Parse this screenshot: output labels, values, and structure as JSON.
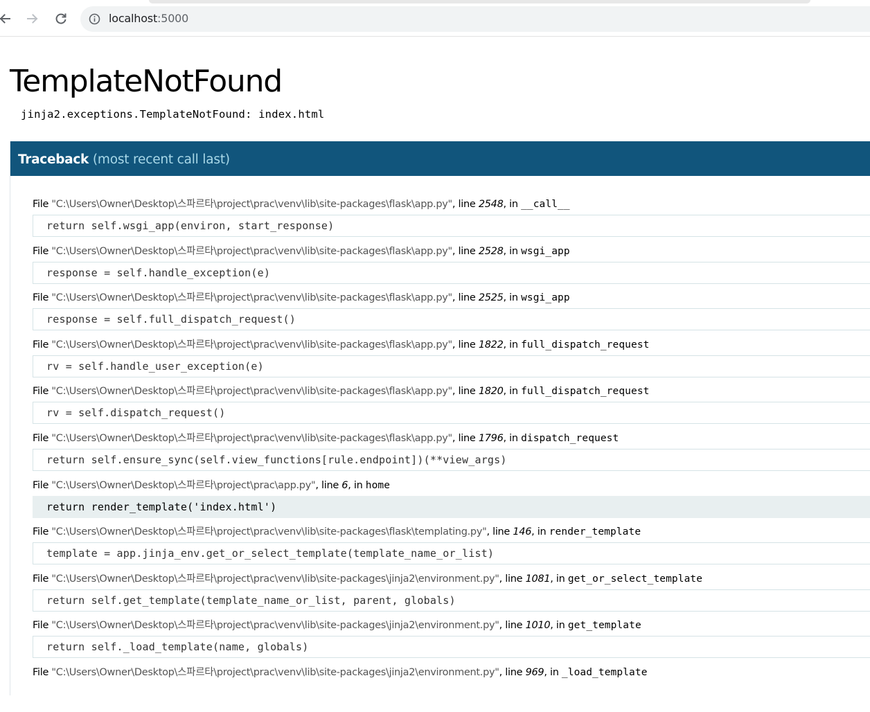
{
  "browser": {
    "url_host": "localhost",
    "url_port": ":5000",
    "icons": {
      "back": "arrow-left-icon",
      "forward": "arrow-right-icon",
      "reload": "reload-icon",
      "info": "info-circle-icon"
    }
  },
  "page": {
    "title": "TemplateNotFound",
    "error_message": "jinja2.exceptions.TemplateNotFound: index.html",
    "traceback_label": "Traceback",
    "traceback_sub": "(most recent call last)",
    "accent_color": "#11557c"
  },
  "frames": [
    {
      "file_prefix": "File ",
      "path": "\"C:\\Users\\Owner\\Desktop\\스파르타\\project\\prac\\venv\\lib\\site-packages\\flask\\app.py\"",
      "line_prefix": ", line ",
      "line": "2548",
      "in_prefix": ", in ",
      "func": "__call__",
      "code": "return self.wsgi_app(environ, start_response)",
      "current": false
    },
    {
      "file_prefix": "File ",
      "path": "\"C:\\Users\\Owner\\Desktop\\스파르타\\project\\prac\\venv\\lib\\site-packages\\flask\\app.py\"",
      "line_prefix": ", line ",
      "line": "2528",
      "in_prefix": ", in ",
      "func": "wsgi_app",
      "code": "response = self.handle_exception(e)",
      "current": false
    },
    {
      "file_prefix": "File ",
      "path": "\"C:\\Users\\Owner\\Desktop\\스파르타\\project\\prac\\venv\\lib\\site-packages\\flask\\app.py\"",
      "line_prefix": ", line ",
      "line": "2525",
      "in_prefix": ", in ",
      "func": "wsgi_app",
      "code": "response = self.full_dispatch_request()",
      "current": false
    },
    {
      "file_prefix": "File ",
      "path": "\"C:\\Users\\Owner\\Desktop\\스파르타\\project\\prac\\venv\\lib\\site-packages\\flask\\app.py\"",
      "line_prefix": ", line ",
      "line": "1822",
      "in_prefix": ", in ",
      "func": "full_dispatch_request",
      "code": "rv = self.handle_user_exception(e)",
      "current": false
    },
    {
      "file_prefix": "File ",
      "path": "\"C:\\Users\\Owner\\Desktop\\스파르타\\project\\prac\\venv\\lib\\site-packages\\flask\\app.py\"",
      "line_prefix": ", line ",
      "line": "1820",
      "in_prefix": ", in ",
      "func": "full_dispatch_request",
      "code": "rv = self.dispatch_request()",
      "current": false
    },
    {
      "file_prefix": "File ",
      "path": "\"C:\\Users\\Owner\\Desktop\\스파르타\\project\\prac\\venv\\lib\\site-packages\\flask\\app.py\"",
      "line_prefix": ", line ",
      "line": "1796",
      "in_prefix": ", in ",
      "func": "dispatch_request",
      "code": "return self.ensure_sync(self.view_functions[rule.endpoint])(**view_args)",
      "current": false
    },
    {
      "file_prefix": "File ",
      "path": "\"C:\\Users\\Owner\\Desktop\\스파르타\\project\\prac\\app.py\"",
      "line_prefix": ", line ",
      "line": "6",
      "in_prefix": ", in ",
      "func": "home",
      "code": "return render_template('index.html')",
      "current": true
    },
    {
      "file_prefix": "File ",
      "path": "\"C:\\Users\\Owner\\Desktop\\스파르타\\project\\prac\\venv\\lib\\site-packages\\flask\\templating.py\"",
      "line_prefix": ", line ",
      "line": "146",
      "in_prefix": ", in ",
      "func": "render_template",
      "code": "template = app.jinja_env.get_or_select_template(template_name_or_list)",
      "current": false
    },
    {
      "file_prefix": "File ",
      "path": "\"C:\\Users\\Owner\\Desktop\\스파르타\\project\\prac\\venv\\lib\\site-packages\\jinja2\\environment.py\"",
      "line_prefix": ", line ",
      "line": "1081",
      "in_prefix": ", in ",
      "func": "get_or_select_template",
      "code": "return self.get_template(template_name_or_list, parent, globals)",
      "current": false
    },
    {
      "file_prefix": "File ",
      "path": "\"C:\\Users\\Owner\\Desktop\\스파르타\\project\\prac\\venv\\lib\\site-packages\\jinja2\\environment.py\"",
      "line_prefix": ", line ",
      "line": "1010",
      "in_prefix": ", in ",
      "func": "get_template",
      "code": "return self._load_template(name, globals)",
      "current": false
    },
    {
      "file_prefix": "File ",
      "path": "\"C:\\Users\\Owner\\Desktop\\스파르타\\project\\prac\\venv\\lib\\site-packages\\jinja2\\environment.py\"",
      "line_prefix": ", line ",
      "line": "969",
      "in_prefix": ", in ",
      "func": "_load_template",
      "code": "",
      "current": false
    }
  ]
}
